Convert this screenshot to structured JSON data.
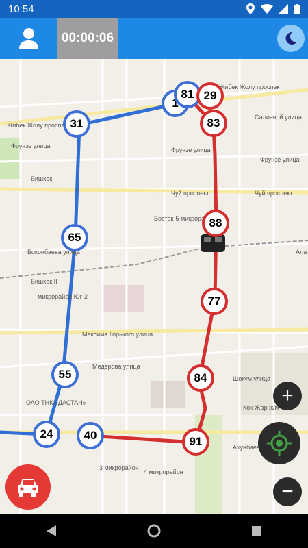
{
  "status_bar": {
    "time": "10:54"
  },
  "header": {
    "timer": "00:00:06",
    "user_icon": "user-icon",
    "theme_icon": "moon-icon"
  },
  "map": {
    "labels": {
      "jibek": "Жибек Жолу проспект",
      "jibek2": "Жибек Жолу проспект",
      "frunze": "Фрунзе улица",
      "frunze2": "Фрунзе улица",
      "frunze3": "Фрунзе улица",
      "saliev": "Салиевой улица",
      "bishkek": "Бишкек",
      "chuy": "Чуй проспект",
      "chuy2": "Чуй проспект",
      "vostok5": "Восток-5 микрорайон",
      "bokonbaev": "Боконбаева улица",
      "mikr_yug": "микрорайон Юг-2",
      "maksim": "Максима Горького улица",
      "mederov": "Медерова улица",
      "akhunbaev": "Ахунбаева улица",
      "mikr3": "3 микрорайон",
      "mikr4": "4 микрорайон",
      "kok_jar": "Кок-Жар ж/м",
      "shukum": "Шокум улица",
      "dastan": "ОАО ТНК «ДАСТАН»",
      "bishkek2": "Бишкек II",
      "alamedin": "Ала"
    },
    "stops": [
      {
        "number": "31",
        "route": "blue"
      },
      {
        "number": "1",
        "route": "blue"
      },
      {
        "number": "81",
        "route": "blue"
      },
      {
        "number": "29",
        "route": "red"
      },
      {
        "number": "83",
        "route": "red"
      },
      {
        "number": "65",
        "route": "blue"
      },
      {
        "number": "88",
        "route": "red"
      },
      {
        "number": "77",
        "route": "red"
      },
      {
        "number": "55",
        "route": "blue"
      },
      {
        "number": "84",
        "route": "red"
      },
      {
        "number": "24",
        "route": "blue"
      },
      {
        "number": "40",
        "route": "blue"
      },
      {
        "number": "91",
        "route": "red"
      }
    ],
    "colors": {
      "blue_route": "#2f6fd6",
      "red_route": "#d32f2f"
    }
  },
  "controls": {
    "zoom_in": "+",
    "zoom_out": "−",
    "locate_icon": "crosshair-icon",
    "car_icon": "car-icon"
  }
}
